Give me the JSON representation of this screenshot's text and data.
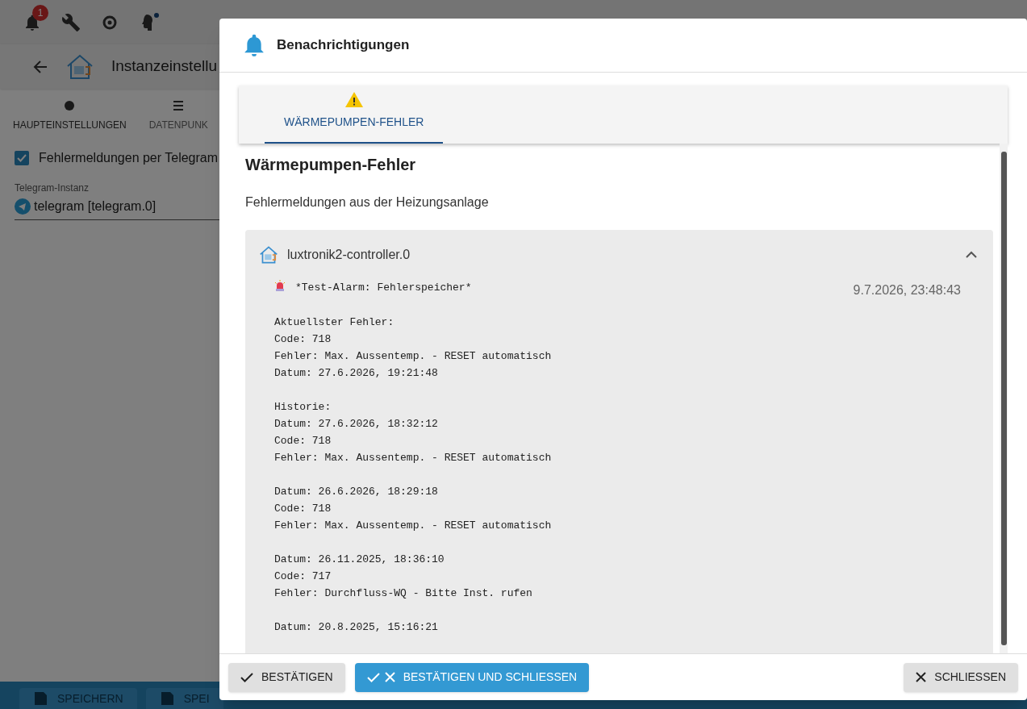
{
  "background": {
    "notification_count": "1",
    "page_title": "Instanzeinstellu",
    "tabs": [
      {
        "label": "HAUPTEINSTELLUNGEN",
        "selected": true
      },
      {
        "label": "DATENPUNK",
        "selected": false
      }
    ],
    "checkbox": {
      "label": "Fehlermeldungen per Telegram",
      "checked": true
    },
    "select": {
      "label": "Telegram-Instanz",
      "value": "telegram [telegram.0]"
    },
    "buttons": [
      "SPEICHERN",
      "SPEI"
    ]
  },
  "dialog": {
    "title": "Benachrichtigungen",
    "tabs": [
      {
        "label": "WÄRMEPUMPEN-FEHLER",
        "selected": true
      }
    ],
    "heading": "Wärmepumpen-Fehler",
    "description": "Fehlermeldungen aus der Heizungsanlage",
    "group": {
      "instance": "luxtronik2-controller.0",
      "expanded": true,
      "message": {
        "title": "*Test-Alarm: Fehlerspeicher*",
        "time": "9.7.2026, 23:48:43",
        "body": "Aktuellster Fehler:\nCode: 718\nFehler: Max. Aussentemp. - RESET automatisch\nDatum: 27.6.2026, 19:21:48\n\nHistorie:\nDatum: 27.6.2026, 18:32:12\nCode: 718\nFehler: Max. Aussentemp. - RESET automatisch\n\nDatum: 26.6.2026, 18:29:18\nCode: 718\nFehler: Max. Aussentemp. - RESET automatisch\n\nDatum: 26.11.2025, 18:36:10\nCode: 717\nFehler: Durchfluss-WQ - Bitte Inst. rufen\n\nDatum: 20.8.2025, 15:16:21"
      }
    },
    "buttons": [
      {
        "kind": "confirm",
        "label": "BESTÄTIGEN"
      },
      {
        "kind": "confirm_close",
        "label": "BESTÄTIGEN UND SCHLIESSEN"
      },
      {
        "kind": "close",
        "label": "SCHLIESSEN"
      }
    ]
  }
}
